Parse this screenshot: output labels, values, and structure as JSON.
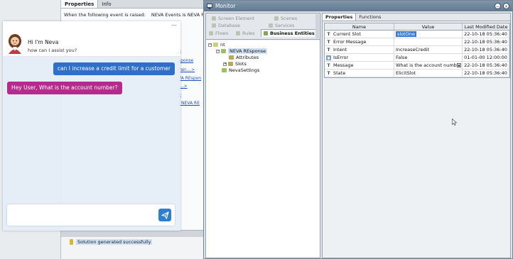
{
  "background_ide": {
    "tabs": [
      "Properties",
      "Info"
    ],
    "event_label": "When the following event is raised:",
    "event_value": "NEVA Events is NEVA Re",
    "side_labels": [
      "e",
      "sponse",
      "Pair....>",
      "VA REspon",
      "....>",
      "e",
      "f NEVA RE"
    ],
    "output_text": "Solution generated successfully"
  },
  "chat": {
    "minimize_label": "—",
    "bot_name": "Hi I'm Neva",
    "bot_subtitle": "how can I assist you?",
    "user_message": "can I increase a credit limit for a customer",
    "bot_message": "Hey User, What is the account number?",
    "input_value": "",
    "send_icon": "send-icon"
  },
  "monitor": {
    "title": "Monitor",
    "controls": [
      "−",
      "×"
    ],
    "tabs": {
      "screen_element": "Screen Element",
      "scenes": "Scenes",
      "database": "Database",
      "services": "Services",
      "flows": "Flows",
      "rules": "Rules",
      "business_entities": "Business Entities"
    },
    "tree": {
      "root": "nt",
      "neva_response": "NEVA REsponse",
      "attributes": "Attributes",
      "slots": "Slots",
      "neva_settings": "NevaSettings"
    },
    "props_tabs": [
      "Properties",
      "Functions"
    ],
    "grid_headers": {
      "name": "Name",
      "value": "Value",
      "date": "Last Modified Date"
    },
    "rows": [
      {
        "type": "T",
        "name": "Current Slot",
        "value": "slotOne",
        "date": "22-10-18 05:36:40"
      },
      {
        "type": "T",
        "name": "Error Message",
        "value": "",
        "date": "22-10-18 05:36:40"
      },
      {
        "type": "T",
        "name": "Intent",
        "value": "IncreaseCredit",
        "date": "22-10-18 05:36:40"
      },
      {
        "type": "B",
        "name": "IsError",
        "value": "False",
        "date": "01-01-00 12:00:00"
      },
      {
        "type": "T",
        "name": "Message",
        "value": "What is the account numb",
        "date": "22-10-18 05:36:40"
      },
      {
        "type": "T",
        "name": "State",
        "value": "ElicitSlot",
        "date": "22-10-18 05:36:40"
      }
    ]
  },
  "colors": {
    "user_bubble": "#2f6fc9",
    "bot_bubble": "#b52a8a",
    "send_button": "#2f7fd0",
    "selected_value": "#3a7ad2"
  }
}
